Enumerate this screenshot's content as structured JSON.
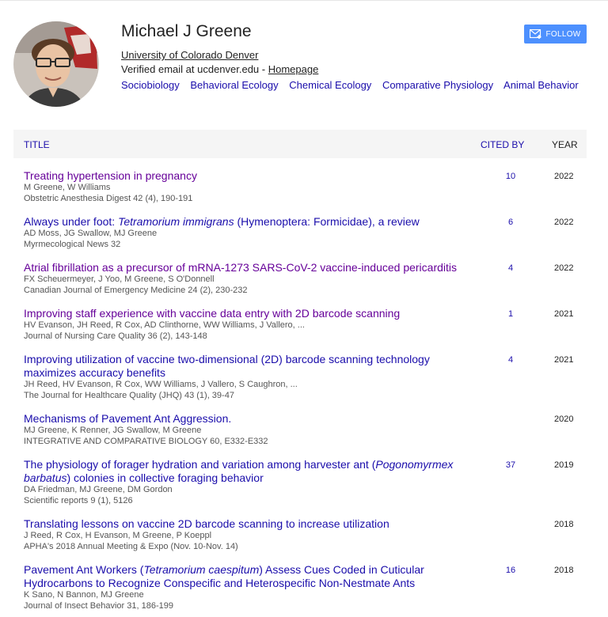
{
  "profile": {
    "name": "Michael J Greene",
    "affiliation": "University of Colorado Denver",
    "verified_prefix": "Verified email at ucdenver.edu - ",
    "homepage_label": "Homepage",
    "interests": [
      "Sociobiology",
      "Behavioral Ecology",
      "Chemical Ecology",
      "Comparative Physiology",
      "Animal Behavior"
    ],
    "avatar_icon": "profile-photo"
  },
  "follow": {
    "label": "FOLLOW",
    "icon": "mail-follow-icon",
    "color": "#4d90fe"
  },
  "table": {
    "headers": {
      "title": "TITLE",
      "cited_by": "CITED BY",
      "year": "YEAR"
    }
  },
  "colors": {
    "link": "#1a0dab",
    "visited": "#660099",
    "meta": "#555555"
  },
  "publications": [
    {
      "title_parts": [
        {
          "t": "Treating hypertension in pregnancy",
          "i": false
        }
      ],
      "visited": true,
      "authors": "M Greene, W Williams",
      "venue": "Obstetric Anesthesia Digest 42 (4), 190-191",
      "cited": "10",
      "year": "2022"
    },
    {
      "title_parts": [
        {
          "t": "Always under foot: ",
          "i": false
        },
        {
          "t": "Tetramorium immigrans",
          "i": true
        },
        {
          "t": " (Hymenoptera: Formicidae), a review",
          "i": false
        }
      ],
      "visited": false,
      "authors": "AD Moss, JG Swallow, MJ Greene",
      "venue": "Myrmecological News 32",
      "cited": "6",
      "year": "2022"
    },
    {
      "title_parts": [
        {
          "t": "Atrial fibrillation as a precursor of mRNA-1273 SARS-CoV-2 vaccine-induced pericarditis",
          "i": false
        }
      ],
      "visited": true,
      "authors": "FX Scheuermeyer, J Yoo, M Greene, S O'Donnell",
      "venue": "Canadian Journal of Emergency Medicine 24 (2), 230-232",
      "cited": "4",
      "year": "2022"
    },
    {
      "title_parts": [
        {
          "t": "Improving staff experience with vaccine data entry with 2D barcode scanning",
          "i": false
        }
      ],
      "visited": true,
      "authors": "HV Evanson, JH Reed, R Cox, AD Clinthorne, WW Williams, J Vallero, ...",
      "venue": "Journal of Nursing Care Quality 36 (2), 143-148",
      "cited": "1",
      "year": "2021"
    },
    {
      "title_parts": [
        {
          "t": "Improving utilization of vaccine two-dimensional (2D) barcode scanning technology maximizes accuracy benefits",
          "i": false
        }
      ],
      "visited": false,
      "authors": "JH Reed, HV Evanson, R Cox, WW Williams, J Vallero, S Caughron, ...",
      "venue": "The Journal for Healthcare Quality (JHQ) 43 (1), 39-47",
      "cited": "4",
      "year": "2021"
    },
    {
      "title_parts": [
        {
          "t": "Mechanisms of Pavement Ant Aggression.",
          "i": false
        }
      ],
      "visited": false,
      "authors": "MJ Greene, K Renner, JG Swallow, M Greene",
      "venue": "INTEGRATIVE AND COMPARATIVE BIOLOGY 60, E332-E332",
      "cited": "",
      "year": "2020"
    },
    {
      "title_parts": [
        {
          "t": "The physiology of forager hydration and variation among harvester ant (",
          "i": false
        },
        {
          "t": "Pogonomyrmex barbatus",
          "i": true
        },
        {
          "t": ") colonies in collective foraging behavior",
          "i": false
        }
      ],
      "visited": false,
      "authors": "DA Friedman, MJ Greene, DM Gordon",
      "venue": "Scientific reports 9 (1), 5126",
      "cited": "37",
      "year": "2019"
    },
    {
      "title_parts": [
        {
          "t": "Translating lessons on vaccine 2D barcode scanning to increase utilization",
          "i": false
        }
      ],
      "visited": false,
      "authors": "J Reed, R Cox, H Evanson, M Greene, P Koeppl",
      "venue": "APHA's 2018 Annual Meeting & Expo (Nov. 10-Nov. 14)",
      "cited": "",
      "year": "2018"
    },
    {
      "title_parts": [
        {
          "t": "Pavement Ant Workers (",
          "i": false
        },
        {
          "t": "Tetramorium caespitum",
          "i": true
        },
        {
          "t": ") Assess Cues Coded in Cuticular Hydrocarbons to Recognize Conspecific and Heterospecific Non-Nestmate Ants",
          "i": false
        }
      ],
      "visited": false,
      "authors": "K Sano, N Bannon, MJ Greene",
      "venue": "Journal of Insect Behavior 31, 186-199",
      "cited": "16",
      "year": "2018"
    }
  ]
}
